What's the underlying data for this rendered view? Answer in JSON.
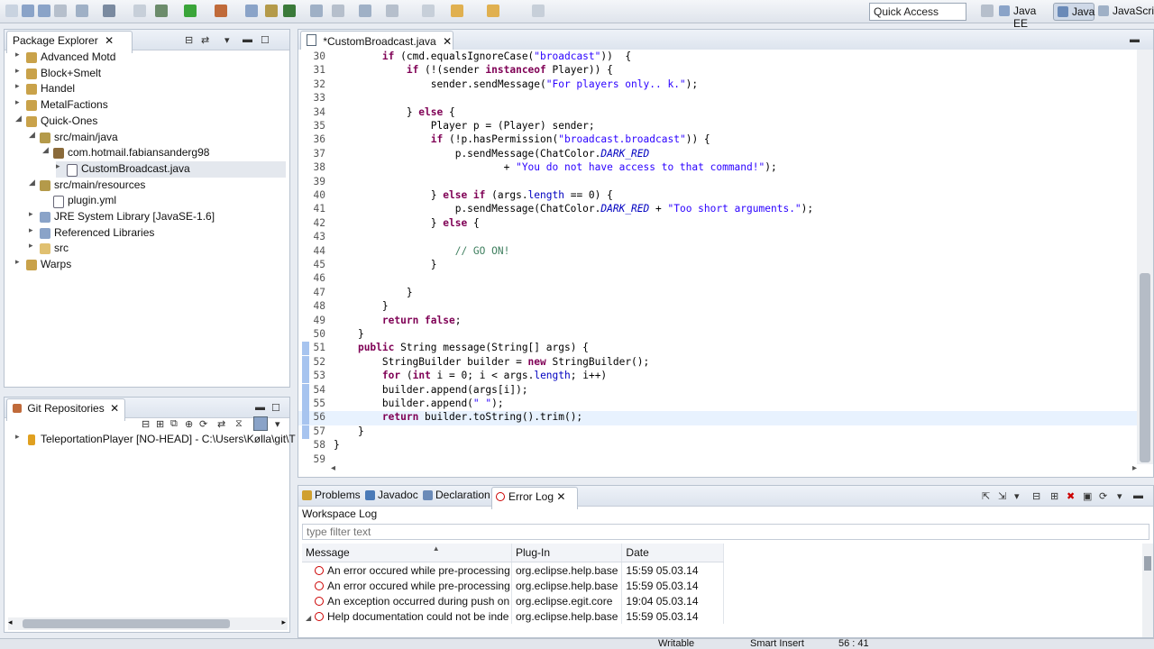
{
  "toolbar": {
    "quick_access_placeholder": "Quick Access",
    "perspectives": [
      "Java EE",
      "Java",
      "JavaScrip"
    ]
  },
  "package_explorer": {
    "tab": "Package Explorer",
    "items": [
      {
        "label": "Advanced Motd",
        "twisty": "▸",
        "icon": "project-icon",
        "depth": 0
      },
      {
        "label": "Block+Smelt",
        "twisty": "▸",
        "icon": "project-icon",
        "depth": 0
      },
      {
        "label": "Handel",
        "twisty": "▸",
        "icon": "project-icon",
        "depth": 0
      },
      {
        "label": "MetalFactions",
        "twisty": "▸",
        "icon": "project-icon",
        "depth": 0
      },
      {
        "label": "Quick-Ones",
        "twisty": "◢",
        "icon": "project-icon",
        "depth": 0
      },
      {
        "label": "src/main/java",
        "twisty": "◢",
        "icon": "source-folder-icon",
        "depth": 1
      },
      {
        "label": "com.hotmail.fabiansanderg98",
        "twisty": "◢",
        "icon": "package-icon",
        "depth": 2
      },
      {
        "label": "CustomBroadcast.java",
        "twisty": "▸",
        "icon": "java-file-icon",
        "depth": 3
      },
      {
        "label": "src/main/resources",
        "twisty": "◢",
        "icon": "source-folder-icon",
        "depth": 1
      },
      {
        "label": "plugin.yml",
        "twisty": "",
        "icon": "file-icon",
        "depth": 2
      },
      {
        "label": "JRE System Library [JavaSE-1.6]",
        "twisty": "▸",
        "icon": "library-icon",
        "depth": 1
      },
      {
        "label": "Referenced Libraries",
        "twisty": "▸",
        "icon": "library-icon",
        "depth": 1
      },
      {
        "label": "src",
        "twisty": "▸",
        "icon": "folder-icon",
        "depth": 1
      },
      {
        "label": "Warps",
        "twisty": "▸",
        "icon": "project-icon",
        "depth": 0
      }
    ]
  },
  "git_repositories": {
    "tab": "Git Repositories",
    "items": [
      {
        "label": "TeleportationPlayer [NO-HEAD] - C:\\Users\\Kølla\\git\\T"
      }
    ]
  },
  "editor": {
    "tab": "*CustomBroadcast.java",
    "current_line": 56,
    "lines": [
      {
        "n": "30",
        "segs": [
          [
            "",
            "        "
          ],
          [
            "kw",
            "if"
          ],
          [
            "",
            " (cmd.equalsIgnoreCase("
          ],
          [
            "st",
            "\"broadcast\""
          ],
          [
            "",
            "))  {"
          ]
        ]
      },
      {
        "n": "31",
        "segs": [
          [
            "",
            "            "
          ],
          [
            "kw",
            "if"
          ],
          [
            "",
            " (!(sender "
          ],
          [
            "kw",
            "instanceof"
          ],
          [
            "",
            " Player)) {"
          ]
        ]
      },
      {
        "n": "32",
        "segs": [
          [
            "",
            "                sender.sendMessage("
          ],
          [
            "st",
            "\"For players only.. k.\""
          ],
          [
            "",
            ");"
          ]
        ]
      },
      {
        "n": "33",
        "segs": [
          [
            "",
            ""
          ]
        ]
      },
      {
        "n": "34",
        "segs": [
          [
            "",
            "            } "
          ],
          [
            "kw",
            "else"
          ],
          [
            "",
            " {"
          ]
        ]
      },
      {
        "n": "35",
        "segs": [
          [
            "",
            "                Player p = (Player) sender;"
          ]
        ]
      },
      {
        "n": "36",
        "segs": [
          [
            "",
            "                "
          ],
          [
            "kw",
            "if"
          ],
          [
            "",
            " (!p.hasPermission("
          ],
          [
            "st",
            "\"broadcast.broadcast\""
          ],
          [
            "",
            ")) {"
          ]
        ]
      },
      {
        "n": "37",
        "segs": [
          [
            "",
            "                    p.sendMessage(ChatColor."
          ],
          [
            "it",
            "DARK_RED"
          ]
        ]
      },
      {
        "n": "38",
        "segs": [
          [
            "",
            "                            + "
          ],
          [
            "st",
            "\"You do not have access to that command!\""
          ],
          [
            "",
            ");"
          ]
        ]
      },
      {
        "n": "39",
        "segs": [
          [
            "",
            ""
          ]
        ]
      },
      {
        "n": "40",
        "segs": [
          [
            "",
            "                } "
          ],
          [
            "kw",
            "else if"
          ],
          [
            "",
            " (args."
          ],
          [
            "fd",
            "length"
          ],
          [
            "",
            " == 0) {"
          ]
        ]
      },
      {
        "n": "41",
        "segs": [
          [
            "",
            "                    p.sendMessage(ChatColor."
          ],
          [
            "it",
            "DARK_RED"
          ],
          [
            "",
            " + "
          ],
          [
            "st",
            "\"Too short arguments.\""
          ],
          [
            "",
            ");"
          ]
        ]
      },
      {
        "n": "42",
        "segs": [
          [
            "",
            "                } "
          ],
          [
            "kw",
            "else"
          ],
          [
            "",
            " {"
          ]
        ]
      },
      {
        "n": "43",
        "segs": [
          [
            "",
            ""
          ]
        ]
      },
      {
        "n": "44",
        "segs": [
          [
            "",
            "                    "
          ],
          [
            "cm",
            "// GO ON!"
          ]
        ]
      },
      {
        "n": "45",
        "segs": [
          [
            "",
            "                }"
          ]
        ]
      },
      {
        "n": "46",
        "segs": [
          [
            "",
            ""
          ]
        ]
      },
      {
        "n": "47",
        "segs": [
          [
            "",
            "            }"
          ]
        ]
      },
      {
        "n": "48",
        "segs": [
          [
            "",
            "        }"
          ]
        ]
      },
      {
        "n": "49",
        "segs": [
          [
            "",
            "        "
          ],
          [
            "kw",
            "return false"
          ],
          [
            "",
            ";"
          ]
        ]
      },
      {
        "n": "50",
        "segs": [
          [
            "",
            "    }"
          ]
        ]
      },
      {
        "n": "51",
        "segs": [
          [
            "",
            "    "
          ],
          [
            "kw",
            "public"
          ],
          [
            "",
            " String message(String[] args) {"
          ]
        ]
      },
      {
        "n": "52",
        "segs": [
          [
            "",
            "        StringBuilder builder = "
          ],
          [
            "kw",
            "new"
          ],
          [
            "",
            " StringBuilder();"
          ]
        ]
      },
      {
        "n": "53",
        "segs": [
          [
            "",
            "        "
          ],
          [
            "kw",
            "for"
          ],
          [
            "",
            " ("
          ],
          [
            "kw",
            "int"
          ],
          [
            "",
            " i = 0; i < args."
          ],
          [
            "fd",
            "length"
          ],
          [
            "",
            "; i++)"
          ]
        ]
      },
      {
        "n": "54",
        "segs": [
          [
            "",
            "        builder.append(args[i]);"
          ]
        ]
      },
      {
        "n": "55",
        "segs": [
          [
            "",
            "        builder.append("
          ],
          [
            "st",
            "\" \""
          ],
          [
            "",
            ");"
          ]
        ]
      },
      {
        "n": "56",
        "segs": [
          [
            "",
            "        "
          ],
          [
            "kw",
            "return"
          ],
          [
            "",
            " builder.toString().trim();"
          ]
        ]
      },
      {
        "n": "57",
        "segs": [
          [
            "",
            "    }"
          ]
        ]
      },
      {
        "n": "58",
        "segs": [
          [
            "",
            "}"
          ]
        ]
      },
      {
        "n": "59",
        "segs": [
          [
            "",
            ""
          ]
        ]
      }
    ]
  },
  "bottom_panel": {
    "tabs": [
      "Problems",
      "Javadoc",
      "Declaration",
      "Error Log"
    ],
    "active_tab": "Error Log",
    "title": "Workspace Log",
    "filter_placeholder": "type filter text",
    "columns": [
      "Message",
      "Plug-In",
      "Date"
    ],
    "rows": [
      {
        "message": "An error occured while pre-processing",
        "plugin": "org.eclipse.help.base",
        "date": "15:59 05.03.14",
        "expander": ""
      },
      {
        "message": "An error occured while pre-processing",
        "plugin": "org.eclipse.help.base",
        "date": "15:59 05.03.14",
        "expander": ""
      },
      {
        "message": "An exception occurred during push on",
        "plugin": "org.eclipse.egit.core",
        "date": "19:04 05.03.14",
        "expander": ""
      },
      {
        "message": "Help documentation could not be inde",
        "plugin": "org.eclipse.help.base",
        "date": "15:59 05.03.14",
        "expander": "◢"
      }
    ]
  },
  "status_bar": {
    "writable": "Writable",
    "insert_mode": "Smart Insert",
    "position": "56 : 41"
  },
  "colors": {
    "keyword": "#7f0055",
    "string": "#2a00ff",
    "comment": "#3f7f5f",
    "field": "#0000c0",
    "current_line": "#e8f2fe",
    "error": "#cc0000"
  }
}
